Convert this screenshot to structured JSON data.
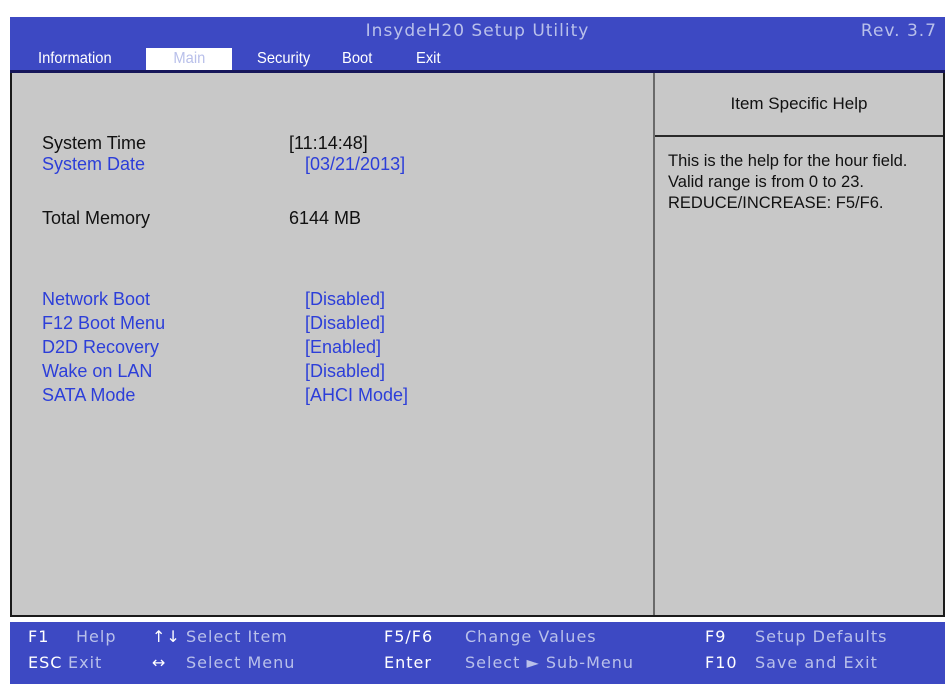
{
  "titlebar": {
    "title": "InsydeH20 Setup Utility",
    "rev": "Rev. 3.7"
  },
  "menu": {
    "information": "Information",
    "main": "Main",
    "security": "Security",
    "boot": "Boot",
    "exit": "Exit",
    "active": "Main"
  },
  "settings": {
    "system_time": {
      "label": "System Time",
      "value": "[11:14:48]"
    },
    "system_date": {
      "label": "System Date",
      "value": "[03/21/2013]"
    },
    "total_memory": {
      "label": "Total Memory",
      "value": "6144 MB"
    },
    "network_boot": {
      "label": "Network Boot",
      "value": "[Disabled]"
    },
    "f12_boot_menu": {
      "label": "F12 Boot Menu",
      "value": "[Disabled]"
    },
    "d2d_recovery": {
      "label": "D2D Recovery",
      "value": "[Enabled]"
    },
    "wake_on_lan": {
      "label": "Wake on LAN",
      "value": "[Disabled]"
    },
    "sata_mode": {
      "label": "SATA Mode",
      "value": "[AHCI Mode]"
    }
  },
  "help": {
    "header": "Item Specific Help",
    "text": "This is the help for the hour field. Valid range is from 0 to 23. REDUCE/INCREASE: F5/F6."
  },
  "footer": {
    "f1_key": "F1",
    "f1_label": "Help",
    "updown_key": "↑↓",
    "updown_label": "Select  Item",
    "f5f6_key": "F5/F6",
    "f5f6_label": "Change  Values",
    "f9_key": "F9",
    "f9_label": "Setup  Defaults",
    "esc_key": "ESC",
    "esc_label": "Exit",
    "leftright_key": "↔",
    "leftright_label": "Select  Menu",
    "enter_key": "Enter",
    "enter_label": "Select  ► Sub-Menu",
    "f10_key": "F10",
    "f10_label": "Save  and  Exit"
  },
  "colors": {
    "bar_blue": "#3d49c3",
    "link_blue": "#2c3ed9",
    "panel_gray": "#c8c8c8",
    "light_text": "#b9c0ea"
  }
}
